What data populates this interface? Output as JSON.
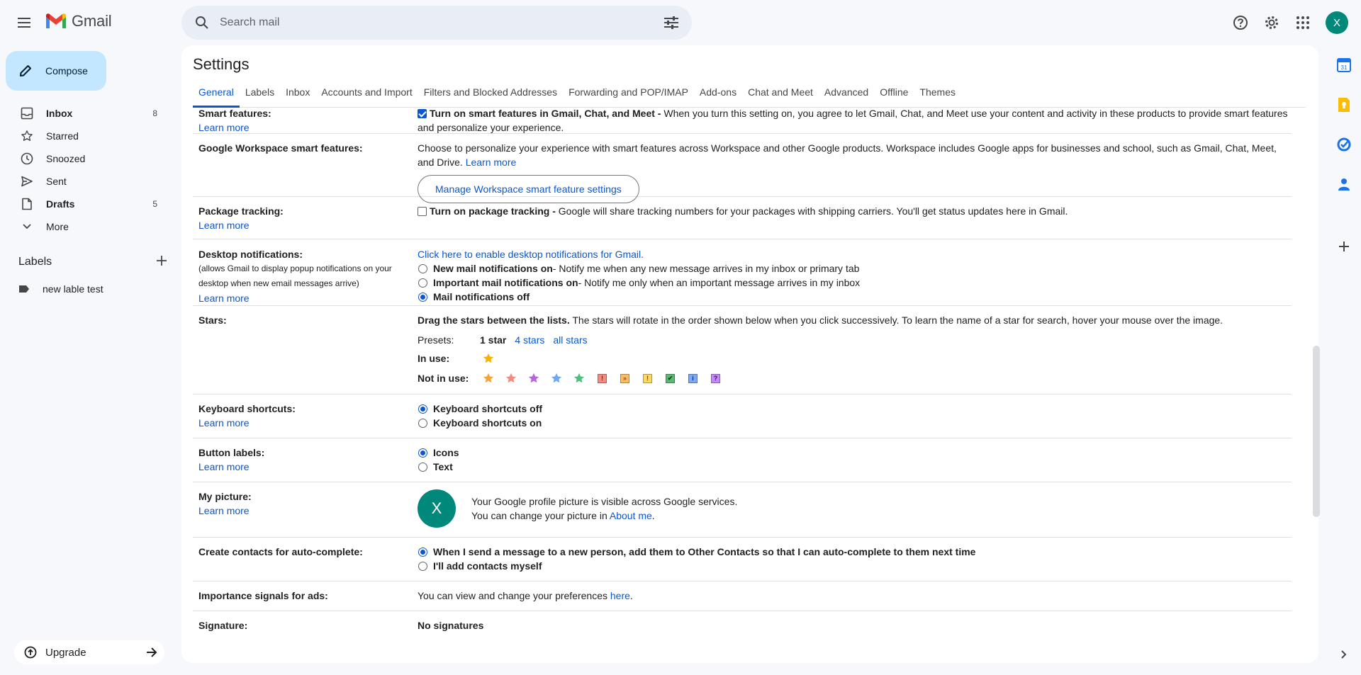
{
  "app": {
    "name": "Gmail"
  },
  "search": {
    "placeholder": "Search mail"
  },
  "user": {
    "initial": "X"
  },
  "compose_label": "Compose",
  "nav": [
    {
      "label": "Inbox",
      "icon": "inbox-icon",
      "count": "8",
      "bold": true
    },
    {
      "label": "Starred",
      "icon": "star-outline-icon",
      "count": "",
      "bold": false
    },
    {
      "label": "Snoozed",
      "icon": "clock-icon",
      "count": "",
      "bold": false
    },
    {
      "label": "Sent",
      "icon": "send-icon",
      "count": "",
      "bold": false
    },
    {
      "label": "Drafts",
      "icon": "draft-icon",
      "count": "5",
      "bold": true
    },
    {
      "label": "More",
      "icon": "chevron-down-icon",
      "count": "",
      "bold": false
    }
  ],
  "labels": {
    "title": "Labels",
    "items": [
      "new lable test"
    ]
  },
  "upgrade_label": "Upgrade",
  "settings": {
    "title": "Settings",
    "tabs": [
      "General",
      "Labels",
      "Inbox",
      "Accounts and Import",
      "Filters and Blocked Addresses",
      "Forwarding and POP/IMAP",
      "Add-ons",
      "Chat and Meet",
      "Advanced",
      "Offline",
      "Themes"
    ],
    "active_tab": "General",
    "learn_more": "Learn more",
    "smart_features": {
      "label": "Smart features:",
      "bold": "Turn on smart features in Gmail, Chat, and Meet -",
      "text": " When you turn this setting on, you agree to let Gmail, Chat, and Meet use your content and activity in these products to provide smart features and personalize your experience.",
      "checked": true
    },
    "workspace": {
      "label": "Google Workspace smart features:",
      "text": "Choose to personalize your experience with smart features across Workspace and other Google products. Workspace includes Google apps for businesses and school, such as Gmail, Chat, Meet, and Drive.",
      "link": "Learn more",
      "button": "Manage Workspace smart feature settings"
    },
    "package": {
      "label": "Package tracking:",
      "bold": "Turn on package tracking -",
      "text": " Google will share tracking numbers for your packages with shipping carriers. You'll get status updates here in Gmail.",
      "checked": false
    },
    "desktop": {
      "label": "Desktop notifications:",
      "sub": "(allows Gmail to display popup notifications on your desktop when new email messages arrive)",
      "link": "Click here to enable desktop notifications for Gmail.",
      "options": [
        {
          "bold": "New mail notifications on",
          "text": " - Notify me when any new message arrives in my inbox or primary tab",
          "selected": false
        },
        {
          "bold": "Important mail notifications on",
          "text": " - Notify me only when an important message arrives in my inbox",
          "selected": false
        },
        {
          "bold": "Mail notifications off",
          "text": "",
          "selected": true
        }
      ]
    },
    "stars": {
      "label": "Stars:",
      "bold": "Drag the stars between the lists.",
      "text": "  The stars will rotate in the order shown below when you click successively. To learn the name of a star for search, hover your mouse over the image.",
      "presets_label": "Presets:",
      "presets": [
        "1 star",
        "4 stars",
        "all stars"
      ],
      "in_use_label": "In use:",
      "not_in_use_label": "Not in use:",
      "in_use": [
        {
          "icon": "yellow-star-icon",
          "color": "#f4b400"
        }
      ],
      "not_in_use_stars": [
        {
          "icon": "orange-star-icon",
          "color": "#f6a33b"
        },
        {
          "icon": "red-star-icon",
          "color": "#f28b82"
        },
        {
          "icon": "purple-star-icon",
          "color": "#b565d9"
        },
        {
          "icon": "blue-star-icon",
          "color": "#6fa8f0"
        },
        {
          "icon": "green-star-icon",
          "color": "#4ebf7e"
        }
      ],
      "not_in_use_marks": [
        {
          "icon": "red-bang-icon",
          "glyph": "!",
          "bg": "#f28b82",
          "fg": "#a50e0e"
        },
        {
          "icon": "orange-guillemet-icon",
          "glyph": "»",
          "bg": "#fbbc65",
          "fg": "#8a4b00"
        },
        {
          "icon": "yellow-bang-icon",
          "glyph": "!",
          "bg": "#fdd663",
          "fg": "#6b5100"
        },
        {
          "icon": "green-check-icon",
          "glyph": "✔",
          "bg": "#5bb974",
          "fg": "#0d3b1c"
        },
        {
          "icon": "blue-info-icon",
          "glyph": "i",
          "bg": "#7baaf7",
          "fg": "#0b2f6b"
        },
        {
          "icon": "purple-question-icon",
          "glyph": "?",
          "bg": "#c58af9",
          "fg": "#3d0a6b"
        }
      ]
    },
    "keyboard": {
      "label": "Keyboard shortcuts:",
      "options": [
        {
          "bold": "Keyboard shortcuts off",
          "selected": true
        },
        {
          "bold": "Keyboard shortcuts on",
          "selected": false
        }
      ]
    },
    "button_labels": {
      "label": "Button labels:",
      "options": [
        {
          "bold": "Icons",
          "selected": true
        },
        {
          "bold": "Text",
          "selected": false
        }
      ]
    },
    "my_picture": {
      "label": "My picture:",
      "line1": "Your Google profile picture is visible across Google services.",
      "line2": "You can change your picture in ",
      "link": "About me",
      "after_link": "."
    },
    "contacts": {
      "label": "Create contacts for auto-complete:",
      "options": [
        {
          "bold": "When I send a message to a new person, add them to Other Contacts so that I can auto-complete to them next time",
          "selected": true
        },
        {
          "bold": "I'll add contacts myself",
          "selected": false
        }
      ]
    },
    "importance": {
      "label": "Importance signals for ads:",
      "text": "You can view and change your preferences ",
      "link": "here",
      "after_link": "."
    },
    "signature": {
      "label": "Signature:",
      "value": "No signatures"
    }
  }
}
